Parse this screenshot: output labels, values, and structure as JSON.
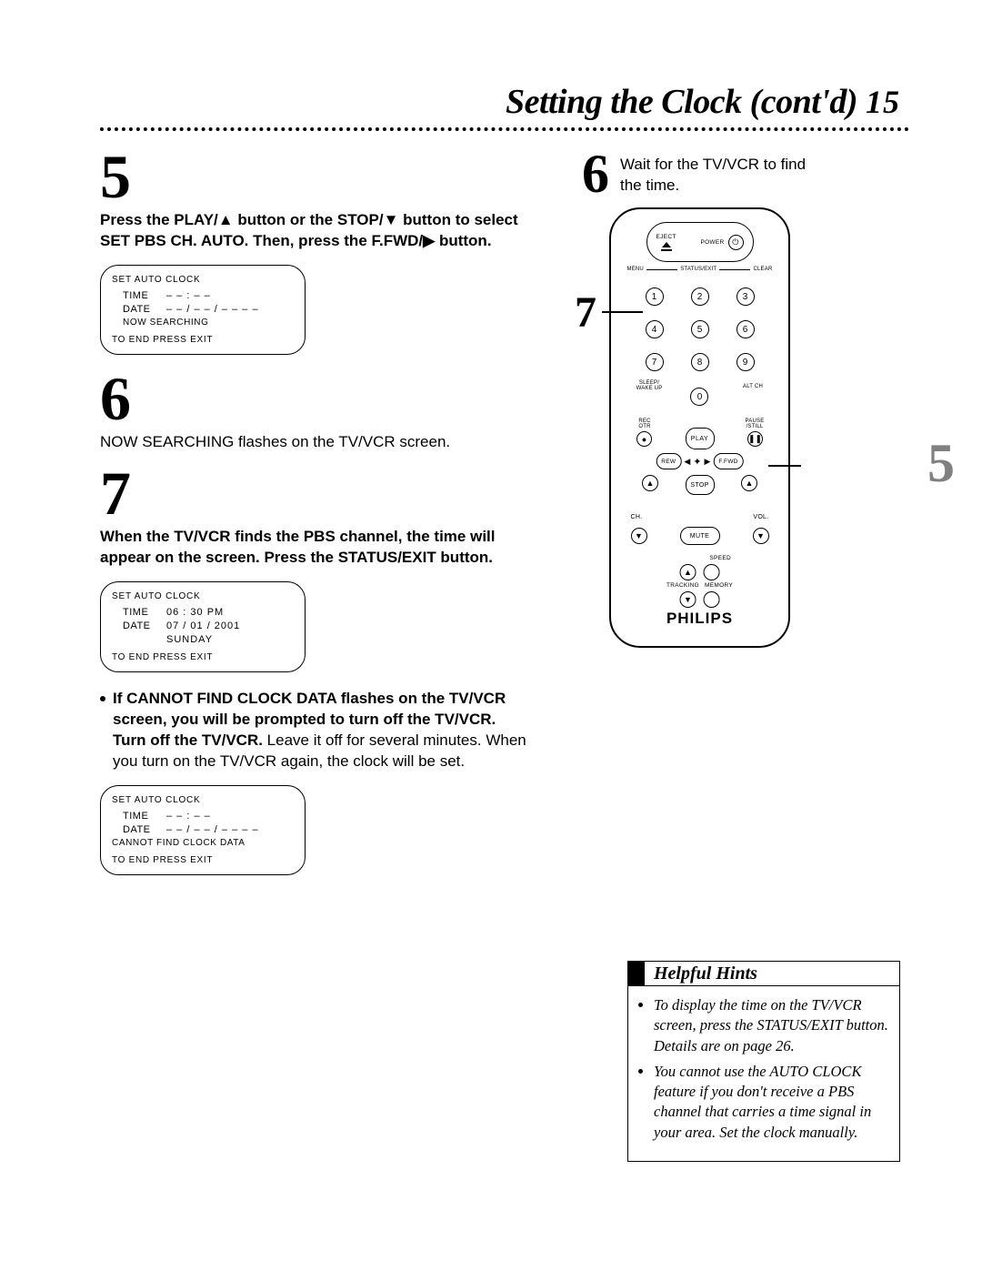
{
  "header": {
    "title": "Setting the Clock (cont'd)",
    "page_number": "15"
  },
  "steps": {
    "five": {
      "num": "5",
      "line1a": "Press the PLAY/",
      "line1b": " button or the STOP/",
      "line1c": " button to select",
      "line2a": "SET PBS CH. AUTO. Then, press the F.FWD/",
      "line2c": " button."
    },
    "six_left": {
      "num": "6",
      "text": "NOW SEARCHING flashes on the TV/VCR screen."
    },
    "seven": {
      "num": "7",
      "line1": "When the TV/VCR finds the PBS channel, the time will",
      "line2": "appear on the screen. Press the STATUS/EXIT button."
    },
    "bullet": {
      "bold1": "If CANNOT FIND CLOCK DATA flashes on the TV/VCR",
      "bold2": "screen, you will be prompted to turn off the TV/VCR.",
      "bold3": "Turn off the TV/VCR.",
      "plain1": " Leave it off for several minutes. When",
      "plain2": "you turn on the TV/VCR again, the clock will be set."
    },
    "six_right": {
      "num": "6",
      "line1": "Wait for the TV/VCR to find",
      "line2": "the time."
    }
  },
  "osd": {
    "a": {
      "hdr": "SET AUTO CLOCK",
      "time_lbl": "TIME",
      "time_val": "– – : – –",
      "date_lbl": "DATE",
      "date_val": "– – / – – / – – – –",
      "mid": "NOW SEARCHING",
      "ftr": "TO END PRESS EXIT"
    },
    "b": {
      "hdr": "SET AUTO CLOCK",
      "time_lbl": "TIME",
      "time_val": "06 : 30 PM",
      "date_lbl": "DATE",
      "date_val": "07 / 01 / 2001",
      "date_day": "SUNDAY",
      "ftr": "TO END PRESS EXIT"
    },
    "c": {
      "hdr": "SET AUTO CLOCK",
      "time_lbl": "TIME",
      "time_val": "– – : – –",
      "date_lbl": "DATE",
      "date_val": "– – / – – / – – – –",
      "mid": "CANNOT FIND CLOCK DATA",
      "ftr": "TO END PRESS EXIT"
    }
  },
  "remote": {
    "eject": "EJECT",
    "power": "POWER",
    "menu": "MENU",
    "statusexit": "STATUS/EXIT",
    "clear": "CLEAR",
    "k1": "1",
    "k2": "2",
    "k3": "3",
    "k4": "4",
    "k5": "5",
    "k6": "6",
    "k7": "7",
    "k8": "8",
    "k9": "9",
    "k0": "0",
    "sleep": "SLEEP/\nWAKE UP",
    "altch": "ALT CH",
    "rec": "REC\nOTR",
    "pause": "PAUSE\n/STILL",
    "play": "PLAY",
    "rew": "REW",
    "ffwd": "F.FWD",
    "stop": "STOP",
    "ch": "CH.",
    "vol": "VOL.",
    "mute": "MUTE",
    "speed": "SPEED",
    "tracking": "TRACKING",
    "memory": "MEMORY",
    "brand": "PHILIPS",
    "callout7": "7",
    "callout5": "5"
  },
  "hints": {
    "title": "Helpful Hints",
    "h1": "To display the time on the TV/VCR screen, press the STATUS/EXIT button. Details are on page 26.",
    "h2": "You cannot use the AUTO CLOCK feature if you don't receive a PBS channel that carries a time signal in your area. Set the clock manually."
  }
}
